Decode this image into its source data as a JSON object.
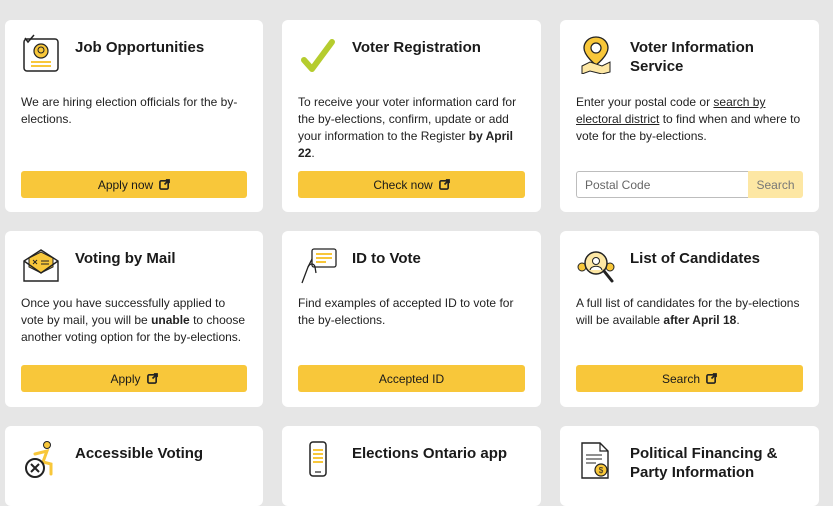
{
  "cards": {
    "jobs": {
      "title": "Job Opportunities",
      "desc": "We are hiring election officials for the by-elections.",
      "button": "Apply now"
    },
    "voter_reg": {
      "title": "Voter Registration",
      "desc_before": "To receive your voter information card for the by-elections, confirm, update or add your information to the Register ",
      "desc_bold": "by April 22",
      "desc_after": ".",
      "button": "Check now"
    },
    "voter_info": {
      "title": "Voter Information Service",
      "desc_before": "Enter your postal code or ",
      "desc_link": "search by electoral district",
      "desc_after": " to find when and where to vote for the by-elections.",
      "placeholder": "Postal Code",
      "button": "Search"
    },
    "mail": {
      "title": "Voting by Mail",
      "desc_before": "Once you have successfully applied to vote by mail, you will be ",
      "desc_bold": "unable",
      "desc_after": " to choose another voting option for the by-elections.",
      "button": "Apply"
    },
    "id": {
      "title": "ID to Vote",
      "desc": "Find examples of accepted ID to vote for the by-elections.",
      "button": "Accepted ID"
    },
    "candidates": {
      "title": "List of Candidates",
      "desc_before": "A full list of candidates for the by-elections will be available ",
      "desc_bold": "after April 18",
      "desc_after": ".",
      "button": "Search"
    },
    "accessible": {
      "title": "Accessible Voting"
    },
    "app": {
      "title": "Elections Ontario app"
    },
    "financing": {
      "title": "Political Financing & Party Information"
    }
  },
  "icons": {
    "jobs": "id-badge-icon",
    "voter_reg": "checkmark-icon",
    "voter_info": "map-pin-icon",
    "mail": "envelope-icon",
    "id": "hand-holding-id-icon",
    "candidates": "magnifier-people-icon",
    "accessible": "accessibility-icon",
    "app": "mobile-phone-icon",
    "financing": "document-money-icon",
    "external": "external-link-icon"
  },
  "colors": {
    "accent": "#f8c73a",
    "accent_light": "#fde7a4",
    "background": "#e6e6e6",
    "check_green": "#b5cc2e"
  }
}
